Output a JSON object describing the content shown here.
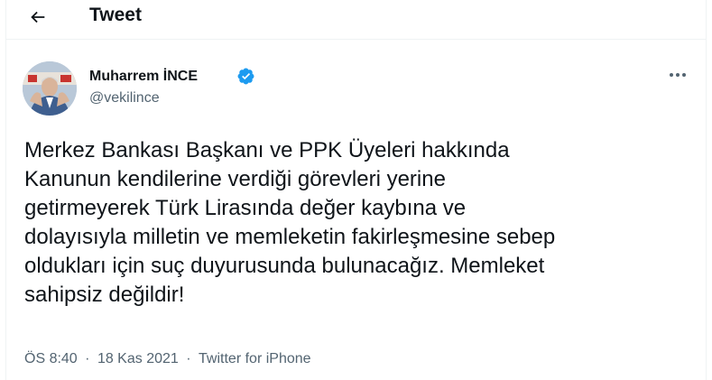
{
  "header": {
    "title": "Tweet",
    "back_icon": "arrow-left-icon"
  },
  "author": {
    "name": "Muharrem İNCE",
    "handle": "@vekilince",
    "verified_icon": "verified-badge-icon",
    "verified_color": "#1d9bf0"
  },
  "more_icon": "more-horizontal-icon",
  "tweet": {
    "text": "Merkez Bankası Başkanı ve PPK Üyeleri hakkında\nKanunun  kendilerine verdiği görevleri yerine\ngetirmeyerek Türk Lirasında değer kaybına ve\ndolayısıyla milletin ve memleketin fakirleşmesine sebep\noldukları için suç duyurusunda bulunacağız. Memleket\nsahipsiz değildir!",
    "time": "ÖS 8:40",
    "separator": "·",
    "date": "18 Kas 2021",
    "source": "Twitter for iPhone"
  },
  "colors": {
    "text_primary": "#0f1419",
    "text_secondary": "#536471",
    "border": "#eff3f4",
    "accent": "#1d9bf0"
  }
}
